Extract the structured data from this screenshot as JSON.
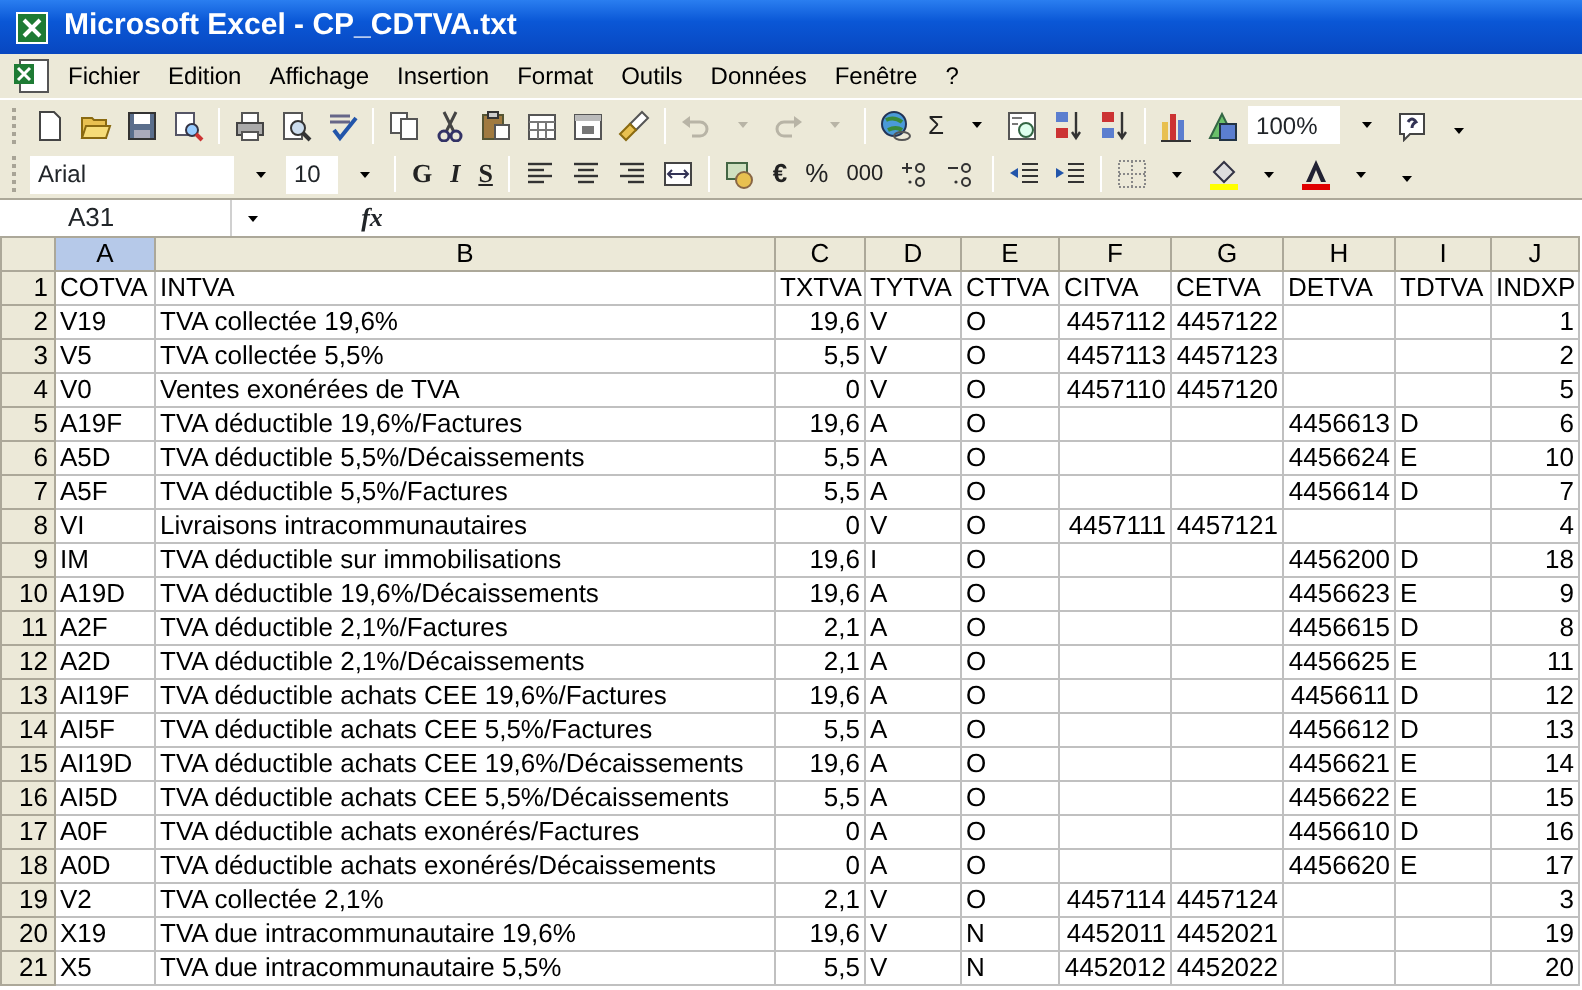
{
  "window": {
    "title": "Microsoft Excel - CP_CDTVA.txt"
  },
  "menu": [
    {
      "label": "Fichier"
    },
    {
      "label": "Edition"
    },
    {
      "label": "Affichage"
    },
    {
      "label": "Insertion"
    },
    {
      "label": "Format"
    },
    {
      "label": "Outils"
    },
    {
      "label": "Données"
    },
    {
      "label": "Fenêtre"
    },
    {
      "label": "?"
    }
  ],
  "standard_toolbar": {
    "undo": {
      "disabled": true
    },
    "redo": {
      "disabled": true
    },
    "sum": "Σ",
    "zoom": "100%"
  },
  "formatting_toolbar": {
    "font": "Arial",
    "size": "10",
    "bold": "G",
    "italic": "I",
    "underline": "S",
    "euro": "€",
    "percent": "%",
    "thousands": "000"
  },
  "formula_bar": {
    "name_box": "A31",
    "function_label": "fx"
  },
  "sheet": {
    "columns": [
      {
        "label": "A",
        "selected": true
      },
      {
        "label": "B",
        "selected": false
      },
      {
        "label": "C",
        "selected": false
      },
      {
        "label": "D",
        "selected": false
      },
      {
        "label": "E",
        "selected": false
      },
      {
        "label": "F",
        "selected": false
      },
      {
        "label": "G",
        "selected": false
      },
      {
        "label": "H",
        "selected": false
      },
      {
        "label": "I",
        "selected": false
      },
      {
        "label": "J",
        "selected": false
      }
    ],
    "rows": [
      {
        "header": "1",
        "cells": [
          "COTVA",
          "INTVA",
          "TXTVA",
          "TYTVA",
          "CTTVA",
          "CITVA",
          "CETVA",
          "DETVA",
          "TDTVA",
          "INDXP"
        ]
      },
      {
        "header": "2",
        "cells": [
          "V19",
          "TVA collectée 19,6%",
          "19,6",
          "V",
          "O",
          "4457112",
          "4457122",
          "",
          "",
          "1"
        ]
      },
      {
        "header": "3",
        "cells": [
          "V5",
          "TVA collectée 5,5%",
          "5,5",
          "V",
          "O",
          "4457113",
          "4457123",
          "",
          "",
          "2"
        ]
      },
      {
        "header": "4",
        "cells": [
          "V0",
          "Ventes exonérées de TVA",
          "0",
          "V",
          "O",
          "4457110",
          "4457120",
          "",
          "",
          "5"
        ]
      },
      {
        "header": "5",
        "cells": [
          "A19F",
          "TVA déductible 19,6%/Factures",
          "19,6",
          "A",
          "O",
          "",
          "",
          "4456613",
          "D",
          "6"
        ]
      },
      {
        "header": "6",
        "cells": [
          "A5D",
          "TVA déductible 5,5%/Décaissements",
          "5,5",
          "A",
          "O",
          "",
          "",
          "4456624",
          "E",
          "10"
        ]
      },
      {
        "header": "7",
        "cells": [
          "A5F",
          "TVA déductible 5,5%/Factures",
          "5,5",
          "A",
          "O",
          "",
          "",
          "4456614",
          "D",
          "7"
        ]
      },
      {
        "header": "8",
        "cells": [
          "VI",
          "Livraisons intracommunautaires",
          "0",
          "V",
          "O",
          "4457111",
          "4457121",
          "",
          "",
          "4"
        ]
      },
      {
        "header": "9",
        "cells": [
          "IM",
          "TVA déductible sur immobilisations",
          "19,6",
          "I",
          "O",
          "",
          "",
          "4456200",
          "D",
          "18"
        ]
      },
      {
        "header": "10",
        "cells": [
          "A19D",
          "TVA déductible 19,6%/Décaissements",
          "19,6",
          "A",
          "O",
          "",
          "",
          "4456623",
          "E",
          "9"
        ]
      },
      {
        "header": "11",
        "cells": [
          "A2F",
          "TVA déductible 2,1%/Factures",
          "2,1",
          "A",
          "O",
          "",
          "",
          "4456615",
          "D",
          "8"
        ]
      },
      {
        "header": "12",
        "cells": [
          "A2D",
          "TVA déductible 2,1%/Décaissements",
          "2,1",
          "A",
          "O",
          "",
          "",
          "4456625",
          "E",
          "11"
        ]
      },
      {
        "header": "13",
        "cells": [
          "AI19F",
          "TVA déductible achats CEE 19,6%/Factures",
          "19,6",
          "A",
          "O",
          "",
          "",
          "4456611",
          "D",
          "12"
        ]
      },
      {
        "header": "14",
        "cells": [
          "AI5F",
          "TVA déductible achats CEE 5,5%/Factures",
          "5,5",
          "A",
          "O",
          "",
          "",
          "4456612",
          "D",
          "13"
        ]
      },
      {
        "header": "15",
        "cells": [
          "AI19D",
          "TVA déductible achats CEE 19,6%/Décaissements",
          "19,6",
          "A",
          "O",
          "",
          "",
          "4456621",
          "E",
          "14"
        ]
      },
      {
        "header": "16",
        "cells": [
          "AI5D",
          "TVA déductible achats CEE 5,5%/Décaissements",
          "5,5",
          "A",
          "O",
          "",
          "",
          "4456622",
          "E",
          "15"
        ]
      },
      {
        "header": "17",
        "cells": [
          "A0F",
          "TVA déductible achats exonérés/Factures",
          "0",
          "A",
          "O",
          "",
          "",
          "4456610",
          "D",
          "16"
        ]
      },
      {
        "header": "18",
        "cells": [
          "A0D",
          "TVA déductible achats exonérés/Décaissements",
          "0",
          "A",
          "O",
          "",
          "",
          "4456620",
          "E",
          "17"
        ]
      },
      {
        "header": "19",
        "cells": [
          "V2",
          "TVA collectée 2,1%",
          "2,1",
          "V",
          "O",
          "4457114",
          "4457124",
          "",
          "",
          "3"
        ]
      },
      {
        "header": "20",
        "cells": [
          "X19",
          "TVA due intracommunautaire 19,6%",
          "19,6",
          "V",
          "N",
          "4452011",
          "4452021",
          "",
          "",
          "19"
        ]
      },
      {
        "header": "21",
        "cells": [
          "X5",
          "TVA due intracommunautaire 5,5%",
          "5,5",
          "V",
          "N",
          "4452012",
          "4452022",
          "",
          "",
          "20"
        ]
      }
    ]
  }
}
